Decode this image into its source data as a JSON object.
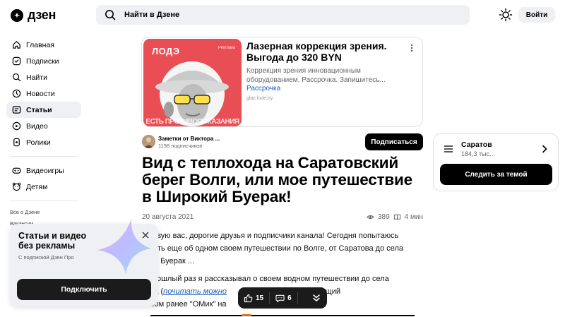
{
  "header": {
    "logo_text": "дзен",
    "search_placeholder": "Найти в Дзене",
    "login_label": "Войти"
  },
  "sidebar": {
    "items": [
      {
        "label": "Главная",
        "icon": "home-icon"
      },
      {
        "label": "Подписки",
        "icon": "subscriptions-icon"
      },
      {
        "label": "Найти",
        "icon": "search-icon"
      },
      {
        "label": "Новости",
        "icon": "news-icon"
      },
      {
        "label": "Статьи",
        "icon": "articles-icon",
        "active": true
      },
      {
        "label": "Видео",
        "icon": "video-icon"
      },
      {
        "label": "Ролики",
        "icon": "shorts-icon"
      },
      {
        "label": "Видеоигры",
        "icon": "gamepad-icon"
      },
      {
        "label": "Детям",
        "icon": "kids-icon"
      }
    ],
    "footer_links": [
      "Все о Дзене",
      "Вакансии"
    ]
  },
  "ad": {
    "brand": "ЛОДЭ",
    "tag": "Реклама",
    "warning": "ЕСТЬ ПРОТИВОПОКАЗАНИЯ",
    "title": "Лазерная коррекция зрения. Выгода до 320 BYN",
    "description": "Коррекция зрения инновационным оборудованием. Рассрочка. Запишитесь...",
    "link": "Рассрочка",
    "domain": "glaz.lode.by"
  },
  "channel": {
    "name": "Заметки от Виктора ...",
    "subscribers": "1198 подписчиков",
    "subscribe_label": "Подписаться"
  },
  "article": {
    "title": "Вид с теплохода на Саратовский берег Волги, или мое путешествие в Широкий Буерак!",
    "date": "20 августа 2021",
    "views": "389",
    "read_time": "4 мин",
    "p1_l1": "етствую вас, дорогие друзья и подписчики канала! Сегодня попытаюсь",
    "p1_l2": "казать еще об одном своем путешествии по Волге, от Саратова до села",
    "p1_l3": "окий Буерак ...",
    "p2_l1": "в прошлый раз я рассказывал о своем водном путешествии до села",
    "p2_l2_a": "ейка (",
    "p2_l2_link": "почитать можно",
    "p2_l2_b": "смотрел на уходящий",
    "p2_l3": "часом ранее \"ОМик\" на"
  },
  "topic": {
    "name": "Саратов",
    "count": "184,3 тыс...",
    "follow_label": "Следить за темой"
  },
  "promo": {
    "title": "Статьи и видео без рекламы",
    "subtitle": "С подпиской Дзен Про",
    "button_label": "Подключить"
  },
  "actions": {
    "likes": "15",
    "comments": "6"
  },
  "colors": {
    "accent": "#000000",
    "link": "#1a5fb4",
    "ad_background": "#e94e55",
    "progress": "#f26b1d"
  }
}
